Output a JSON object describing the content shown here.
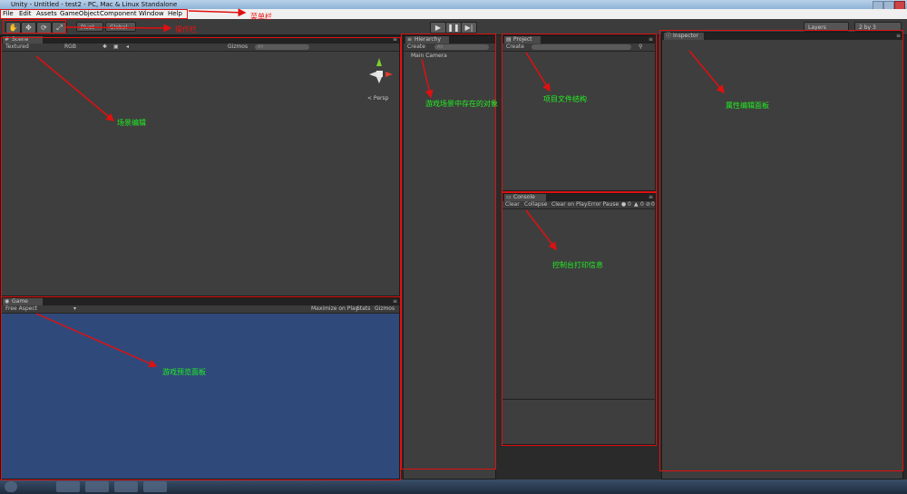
{
  "window": {
    "title": "Unity - Untitled - test2 - PC, Mac & Linux Standalone"
  },
  "menu": {
    "items": [
      "File",
      "Edit",
      "Assets",
      "GameObject",
      "Component",
      "Window",
      "Help"
    ]
  },
  "toolbar": {
    "tools": [
      "hand-icon",
      "move-icon",
      "rotate-icon",
      "scale-icon"
    ],
    "pivot_label": "Pivot",
    "global_label": "Global",
    "play_icons": [
      "play-icon",
      "pause-icon",
      "step-icon"
    ],
    "layers_label": "Layers",
    "layout_label": "2 by 3"
  },
  "scene": {
    "tab": "Scene",
    "shading": "Textured",
    "render_mode": "RGB",
    "gizmos": "Gizmos",
    "search": "All",
    "persp": "< Persp"
  },
  "game": {
    "tab": "Game",
    "aspect": "Free Aspect",
    "maximize": "Maximize on Play",
    "stats": "Stats",
    "gizmos": "Gizmos"
  },
  "hierarchy": {
    "tab": "Hierarchy",
    "create": "Create",
    "search": "All",
    "items": [
      "Main Camera"
    ]
  },
  "project": {
    "tab": "Project",
    "create": "Create"
  },
  "console": {
    "tab": "Console",
    "buttons": [
      "Clear",
      "Collapse",
      "Clear on Play",
      "Error Pause"
    ],
    "counts": {
      "info": "0",
      "warn": "0",
      "error": "0"
    }
  },
  "inspector": {
    "tab": "Inspector"
  },
  "annotations": {
    "menu": "菜单栏",
    "toolbar": "操作栏",
    "scene": "场景编辑",
    "hierarchy": "游戏场景中存在的对象",
    "project": "项目文件结构",
    "inspector": "属性编辑面板",
    "console": "控制台打印信息",
    "game": "游戏预览面板"
  },
  "colors": {
    "annotation_text": "#22ee22",
    "annotation_box": "#e01010",
    "game_bg": "#2f4a7a",
    "panel_bg": "#3e3e3e"
  }
}
